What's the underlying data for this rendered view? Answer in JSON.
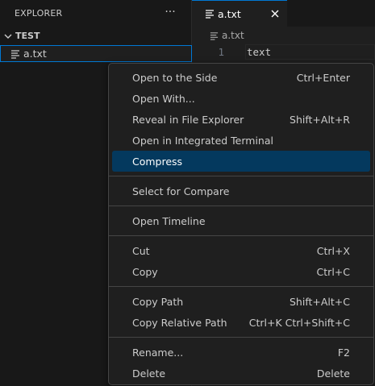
{
  "sidebar": {
    "title": "EXPLORER",
    "more_icon": "ellipsis-icon",
    "folder": {
      "name": "TEST"
    },
    "file": {
      "name": "a.txt"
    }
  },
  "editor": {
    "tab": {
      "label": "a.txt"
    },
    "breadcrumb": "a.txt",
    "lines": [
      {
        "number": "1",
        "text": "text"
      }
    ]
  },
  "context_menu": {
    "groups": [
      [
        {
          "label": "Open to the Side",
          "shortcut": "Ctrl+Enter"
        },
        {
          "label": "Open With...",
          "shortcut": ""
        },
        {
          "label": "Reveal in File Explorer",
          "shortcut": "Shift+Alt+R"
        },
        {
          "label": "Open in Integrated Terminal",
          "shortcut": ""
        },
        {
          "label": "Compress",
          "shortcut": "",
          "highlighted": true
        }
      ],
      [
        {
          "label": "Select for Compare",
          "shortcut": ""
        }
      ],
      [
        {
          "label": "Open Timeline",
          "shortcut": ""
        }
      ],
      [
        {
          "label": "Cut",
          "shortcut": "Ctrl+X"
        },
        {
          "label": "Copy",
          "shortcut": "Ctrl+C"
        }
      ],
      [
        {
          "label": "Copy Path",
          "shortcut": "Shift+Alt+C"
        },
        {
          "label": "Copy Relative Path",
          "shortcut": "Ctrl+K Ctrl+Shift+C"
        }
      ],
      [
        {
          "label": "Rename...",
          "shortcut": "F2"
        },
        {
          "label": "Delete",
          "shortcut": "Delete"
        }
      ]
    ]
  },
  "colors": {
    "accent": "#0078d4",
    "menu_highlight": "#04395e",
    "background": "#1f1f1f",
    "sidebar": "#181818"
  }
}
